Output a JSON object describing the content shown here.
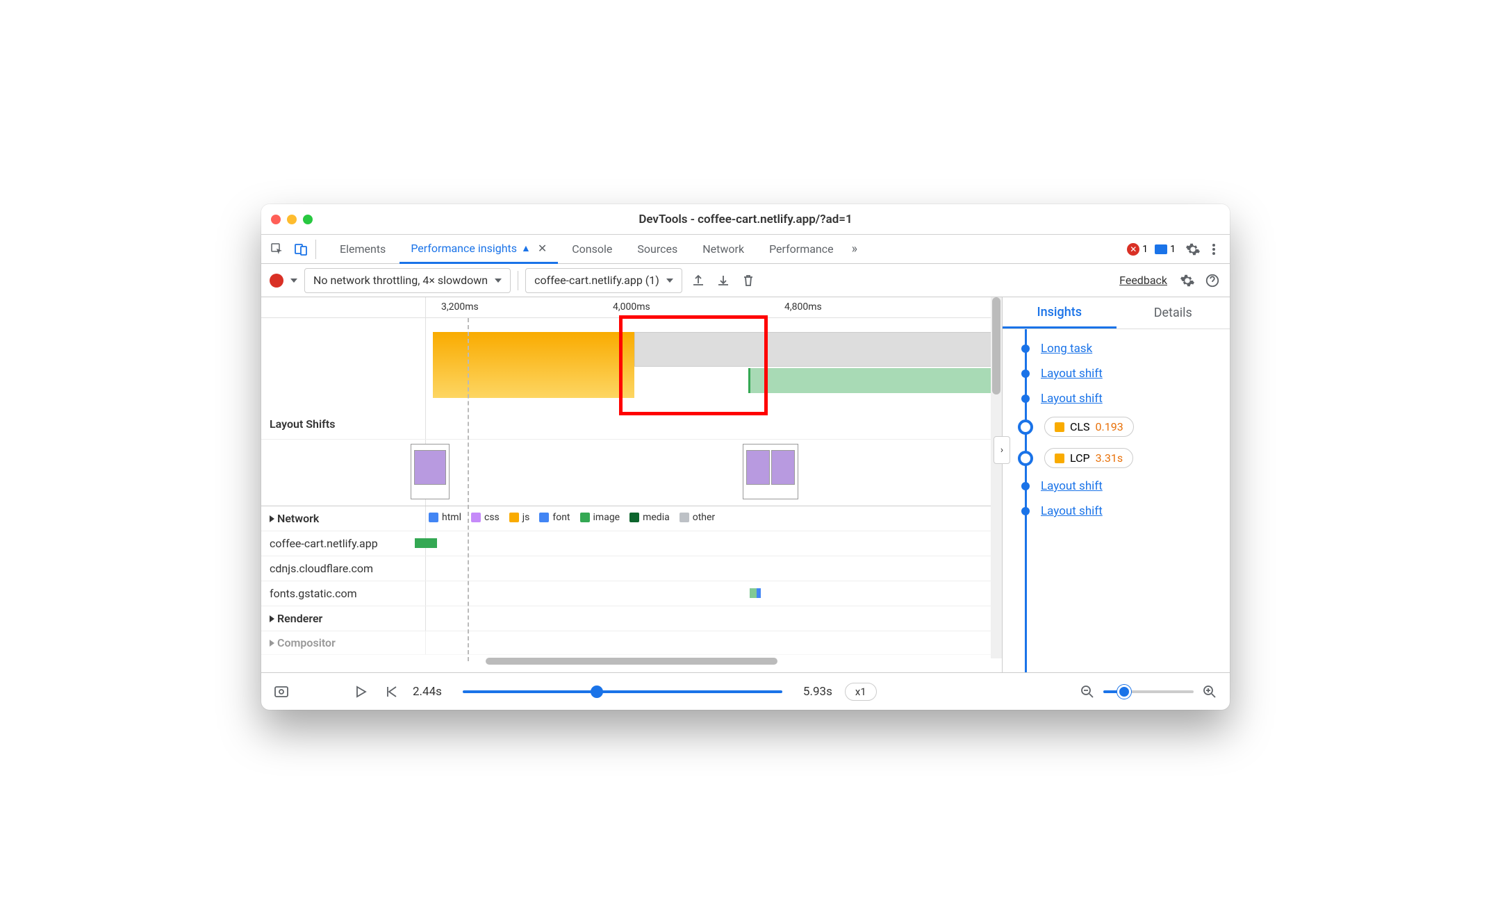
{
  "window": {
    "title": "DevTools - coffee-cart.netlify.app/?ad=1"
  },
  "tabs": {
    "items": [
      "Elements",
      "Performance insights",
      "Console",
      "Sources",
      "Network",
      "Performance"
    ],
    "active_index": 1,
    "errors_count": "1",
    "messages_count": "1"
  },
  "toolbar": {
    "throttling": "No network throttling, 4× slowdown",
    "recording": "coffee-cart.netlify.app (1)",
    "feedback": "Feedback"
  },
  "ruler": {
    "ticks": [
      "3,200ms",
      "4,000ms",
      "4,800ms"
    ],
    "lcp_badge": "LCP"
  },
  "tracks": {
    "layout_shifts": "Layout Shifts",
    "network": "Network",
    "renderer": "Renderer",
    "compositor": "Compositor",
    "network_hosts": [
      "coffee-cart.netlify.app",
      "cdnjs.cloudflare.com",
      "fonts.gstatic.com"
    ],
    "legend": [
      "html",
      "css",
      "js",
      "font",
      "image",
      "media",
      "other"
    ],
    "legend_colors": [
      "#4285f4",
      "#c58af9",
      "#f9ab00",
      "#4285f4",
      "#34a853",
      "#0d652d",
      "#bdc1c6"
    ]
  },
  "right_panel": {
    "tabs": [
      "Insights",
      "Details"
    ],
    "active_tab": 0,
    "items": [
      {
        "type": "link",
        "label": "Long task"
      },
      {
        "type": "link",
        "label": "Layout shift"
      },
      {
        "type": "link",
        "label": "Layout shift"
      },
      {
        "type": "pill",
        "label": "CLS",
        "value": "0.193",
        "color": "#f9ab00"
      },
      {
        "type": "pill",
        "label": "LCP",
        "value": "3.31s",
        "color": "#f9ab00"
      },
      {
        "type": "link",
        "label": "Layout shift"
      },
      {
        "type": "link",
        "label": "Layout shift"
      }
    ]
  },
  "bottombar": {
    "start": "2.44s",
    "end": "5.93s",
    "speed": "x1"
  }
}
